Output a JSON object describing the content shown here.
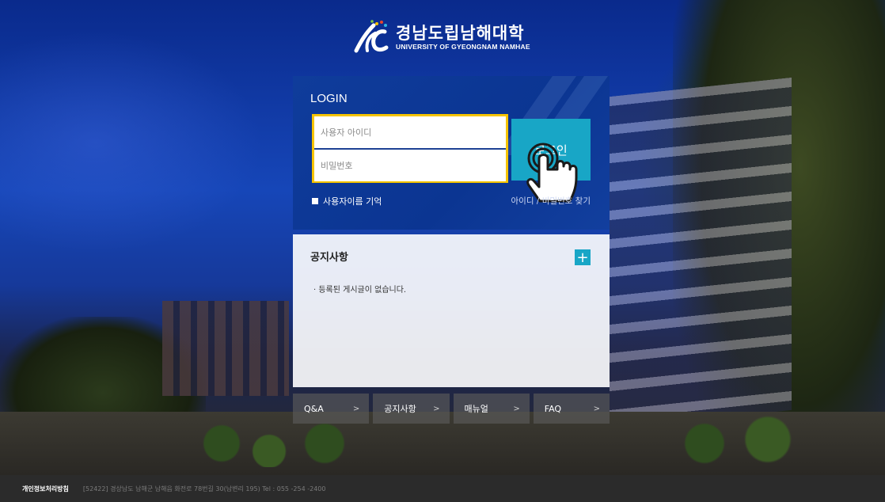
{
  "logo": {
    "korean_name": "경남도립남해대학",
    "english_name": "UNIVERSITY OF GYEONGNAM NAMHAE",
    "mark_icon": "ngc-swoosh-logo"
  },
  "login": {
    "title": "LOGIN",
    "username_placeholder": "사용자 아이디",
    "password_placeholder": "비밀번호",
    "button_label": "로그인",
    "remember_label": "사용자이름 기억",
    "find_label": "아이디 / 비밀번호 찾기",
    "highlight_color": "#f5c400",
    "accent_color": "#18a6c6"
  },
  "notice": {
    "title": "공지사항",
    "empty_message": "· 등록된 게시글이 없습니다.",
    "more_icon": "plus-icon"
  },
  "quick_links": [
    {
      "label": "Q&A"
    },
    {
      "label": "공지사항"
    },
    {
      "label": "매뉴얼"
    },
    {
      "label": "FAQ"
    }
  ],
  "footer": {
    "policy_label": "개인정보처리방침",
    "address": "[52422] 경상남도 남해군 남해읍 화전로 78번길 30(남변리 195)  Tel : 055 -254 -2400"
  }
}
